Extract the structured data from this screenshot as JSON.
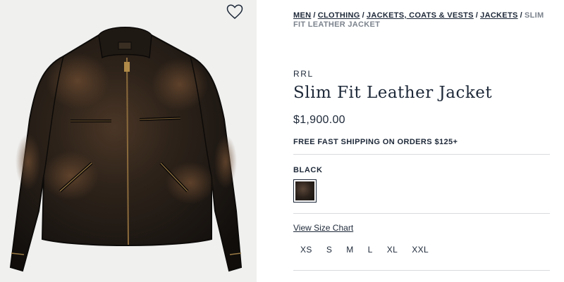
{
  "breadcrumb": {
    "links": [
      "MEN",
      "CLOTHING",
      "JACKETS, COATS & VESTS",
      "JACKETS"
    ],
    "separator": "/",
    "current": "SLIM FIT LEATHER JACKET"
  },
  "product": {
    "brand": "RRL",
    "title": "Slim Fit Leather Jacket",
    "price": "$1,900.00",
    "shipping": "FREE FAST SHIPPING ON ORDERS $125+",
    "color_label": "BLACK",
    "size_chart_link": "View Size Chart",
    "sizes": [
      "XS",
      "S",
      "M",
      "L",
      "XL",
      "XXL"
    ]
  },
  "icons": {
    "wishlist": "heart-icon",
    "product_image": "leather-jacket-image"
  },
  "colors": {
    "text": "#1d2838",
    "muted": "#7c838d",
    "divider": "#d9dbde",
    "image_bg": "#f0f0ef"
  }
}
